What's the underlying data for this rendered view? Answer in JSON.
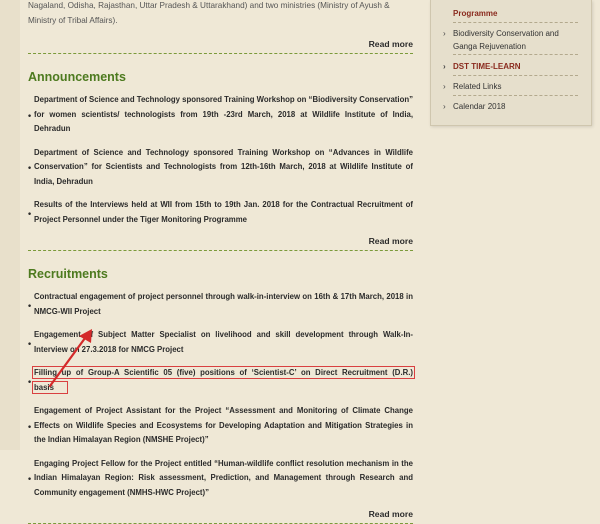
{
  "main": {
    "intro_text": "Nagaland, Odisha, Rajasthan, Uttar Pradesh & Uttarakhand) and two ministries (Ministry of Ayush & Ministry of Tribal Affairs).",
    "read_more": "Read more",
    "announcements": {
      "title": "Announcements",
      "items": [
        "Department of Science and Technology sponsored Training Workshop on “Biodiversity Conservation” for women scientists/ technologists from 19th -23rd March, 2018 at Wildlife Institute of India, Dehradun",
        "Department of Science and Technology sponsored Training Workshop on “Advances in Wildlife Conservation” for Scientists and Technologists from 12th-16th March, 2018 at Wildlife Institute of India, Dehradun",
        "Results of the Interviews held at WII from 15th to 19th Jan. 2018 for the Contractual Recruitment of Project Personnel under the Tiger Monitoring Programme"
      ]
    },
    "recruitments": {
      "title": "Recruitments",
      "items": [
        "Contractual engagement of project personnel through walk-in-interview on 16th & 17th March, 2018 in NMCG-WII Project",
        "Engagement of Subject Matter Specialist on livelihood and skill development through Walk-In-Interview on 27.3.2018 for NMCG Project",
        "Filling up of Group-A Scientific 05 (five) positions of ‘Scientist-C’ on Direct Recruitment (D.R.) basis",
        "Engagement of Project Assistant for the Project “Assessment and Monitoring of Climate Change Effects on Wildlife Species and Ecosystems for Developing Adaptation and Mitigation Strategies in the Indian Himalayan Region (NMSHE Project)”",
        "Engaging Project Fellow for the Project entitled “Human-wildlife conflict resolution mechanism in the Indian Himalayan Region: Risk assessment, Prediction, and Management through Research and Community engagement (NMHS-HWC Project)”"
      ]
    }
  },
  "sidebar": {
    "items": [
      "Programme",
      "Biodiversity Conservation and Ganga Rejuvenation",
      "DST TIME-LEARN",
      "Related Links",
      "Calendar 2018"
    ]
  },
  "colors": {
    "section_title": "#4d7a1f",
    "highlight_box": "#d94040",
    "annotation_arrow": "#d42a2a"
  }
}
